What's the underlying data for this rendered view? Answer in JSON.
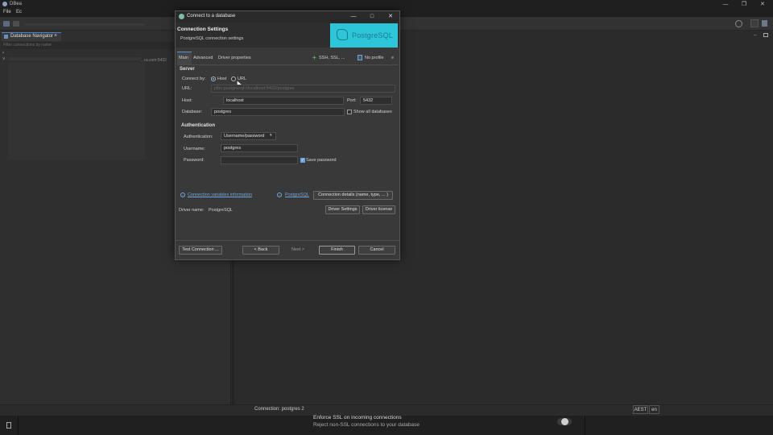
{
  "app": {
    "title": "DBea",
    "menu": [
      "File",
      "Ec"
    ],
    "window_buttons": [
      "—",
      "❐",
      "✕"
    ]
  },
  "navigator": {
    "tab_label": "Database Navigator",
    "filter_placeholder": "Filter connections by name",
    "host_fragment": "...ra.com:5432"
  },
  "statusbar": {
    "connection_text": "Connection: postgres 2",
    "timezone": "AEST",
    "locale": "en"
  },
  "toast": {
    "title": "Enforce SSL on incoming connections",
    "body": "Reject non-SSL connections to your database"
  },
  "dialog": {
    "title": "Connect to a database",
    "header_title": "Connection Settings",
    "header_subtitle": "PostgreSQL connection settings",
    "logo_text": "PostgreSQL",
    "tabs": [
      "Main",
      "Advanced",
      "Driver properties"
    ],
    "ssh_label": "SSH, SSL, ...",
    "profile_label": "No profile",
    "server": {
      "section_title": "Server",
      "connect_by_label": "Connect by:",
      "option_host": "Host",
      "option_url": "URL",
      "url_label": "URL:",
      "url_value": "jdbc:postgresql://localhost:5432/postgres",
      "host_label": "Host:",
      "host_value": "localhost",
      "port_label": "Port:",
      "port_value": "5432",
      "database_label": "Database:",
      "database_value": "postgres",
      "show_all_label": "Show all databases"
    },
    "auth": {
      "section_title": "Authentication",
      "auth_label": "Authentication:",
      "auth_value": "Username/password",
      "username_label": "Username:",
      "username_value": "postgres",
      "password_label": "Password:",
      "password_value": "",
      "save_password_label": "Save password"
    },
    "links": {
      "variables_info": "Connection variables information",
      "postgresql": "PostgreSQL",
      "details_button": "Connection details (name, type, ... )"
    },
    "driver": {
      "name_label": "Driver name:",
      "name_value": "PostgreSQL",
      "settings_button": "Driver Settings",
      "license_button": "Driver license"
    },
    "footer": {
      "test_button": "Test Connection ...",
      "back_button": "< Back",
      "next_button": "Next >",
      "finish_button": "Finish",
      "cancel_button": "Cancel"
    }
  }
}
